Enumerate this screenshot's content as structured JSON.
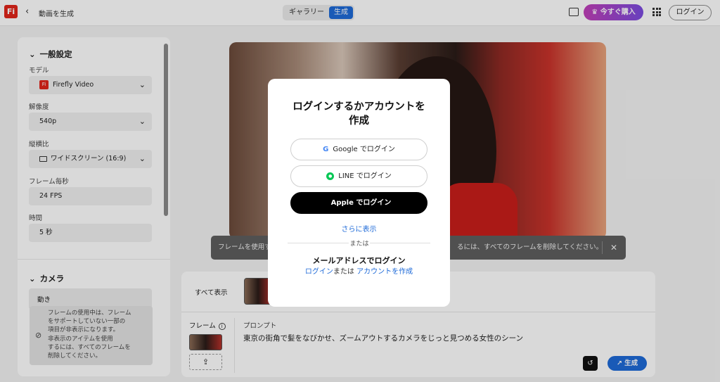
{
  "header": {
    "logo_text": "Fi",
    "back_icon": "chevron-left-icon",
    "title": "動画を生成",
    "tabs": [
      {
        "label": "ギャラリー",
        "active": false
      },
      {
        "label": "生成",
        "active": true
      }
    ],
    "buy_label": "今すぐ購入",
    "login_label": "ログイン"
  },
  "sidebar": {
    "general_section": "一般設定",
    "model_label": "モデル",
    "model_value": "Firefly Video",
    "resolution_label": "解像度",
    "resolution_value": "540p",
    "aspect_label": "縦横比",
    "aspect_value": "ワイドスクリーン (16:9)",
    "fps_label": "フレーム毎秒",
    "fps_value": "24 FPS",
    "duration_label": "時間",
    "duration_value": "5 秒",
    "camera_section": "カメラ",
    "motion_label": "動き",
    "tooltip": [
      "フレームの使用中は、フレーム",
      "をサポートしていない一部の",
      "項目が非表示になります。",
      "非表示のアイテムを使用",
      "するには、すべてのフレームを",
      "削除してください。"
    ]
  },
  "toast": {
    "text_left": "フレームを使用す",
    "text_right": "るには、すべてのフレームを削除してください。"
  },
  "bottom_panel": {
    "show_all": "すべて表示",
    "frame_label": "フレーム",
    "prompt_label": "プロンプト",
    "prompt_text": "東京の街角で髪をなびかせ、ズームアウトするカメラをじっと見つめる女性のシーン",
    "generate_label": "生成"
  },
  "modal": {
    "title_line1": "ログインするかアカウントを",
    "title_line2": "作成",
    "google_label": "Google でログイン",
    "line_label": "LINE でログイン",
    "apple_label": "Apple でログイン",
    "more_label": "さらに表示",
    "or_label": "または",
    "email_heading": "メールアドレスでログイン",
    "login_link": "ログイン",
    "or_text": "または",
    "create_link": "アカウントを作成"
  },
  "colors": {
    "accent": "#1e6ad8",
    "brand": "#e1251b"
  }
}
